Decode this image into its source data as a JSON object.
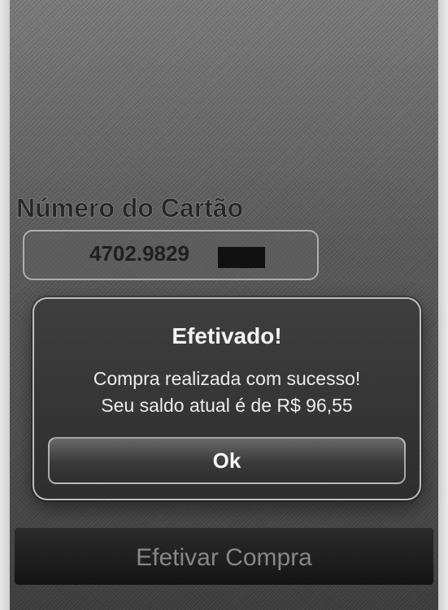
{
  "form": {
    "card_label": "Número do Cartão",
    "card_number": "4702.9829",
    "purchase_button": "Efetivar Compra"
  },
  "alert": {
    "title": "Efetivado!",
    "message_line1": "Compra realizada com sucesso!",
    "message_line2": "Seu saldo atual é de R$ 96,55",
    "ok_button": "Ok"
  }
}
